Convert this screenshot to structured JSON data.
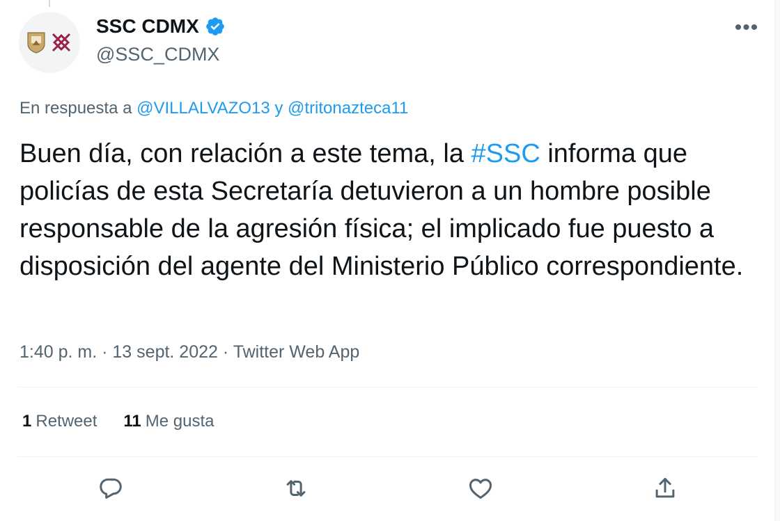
{
  "tweet": {
    "author": {
      "display_name": "SSC CDMX",
      "handle": "@SSC_CDMX",
      "verified": true,
      "avatar_icon": "cdmx-coat-of-arms-logo"
    },
    "more_icon_glyph": "•••",
    "reply_context": {
      "prefix": "En respuesta a",
      "mention_1": "@VILLALVAZO13",
      "joiner": "y",
      "mention_2": "@tritonazteca11"
    },
    "text": {
      "part_1": "Buen día, con relación a este tema, la ",
      "hashtag": "#SSC",
      "part_2": " informa que policías de esta Secretaría detuvieron a un hombre posible responsable de la agresión física; el implicado fue puesto a disposición del agente del Ministerio Público correspondiente."
    },
    "meta": {
      "time": "1:40 p. m.",
      "separator": "·",
      "date": "13 sept. 2022",
      "source": "Twitter Web App"
    },
    "stats": {
      "retweets_count": "1",
      "retweets_label": "Retweet",
      "likes_count": "11",
      "likes_label": "Me gusta"
    },
    "actions": [
      "reply-icon",
      "retweet-icon",
      "like-icon",
      "share-icon"
    ]
  },
  "colors": {
    "accent": "#1d9bf0",
    "text": "#0f1419",
    "secondary": "#536471",
    "divider": "#eff3f4"
  }
}
